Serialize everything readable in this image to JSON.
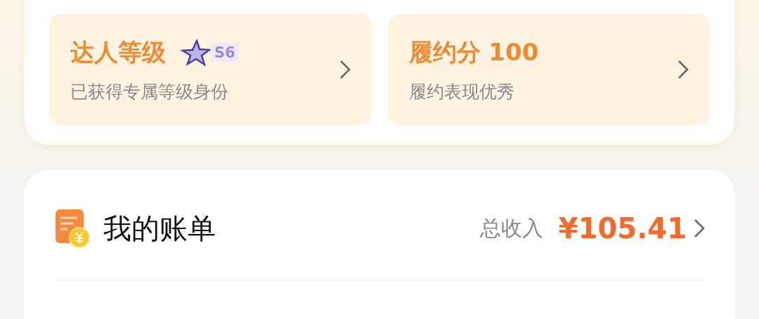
{
  "stat_cards": [
    {
      "kind": "level",
      "title": "达人等级",
      "badge": "S6",
      "subtitle": "已获得专属等级身份"
    },
    {
      "kind": "score",
      "title": "履约分 100",
      "subtitle": "履约表现优秀"
    }
  ],
  "bill": {
    "title": "我的账单",
    "total_label": "总收入",
    "total_amount": "¥105.41"
  }
}
